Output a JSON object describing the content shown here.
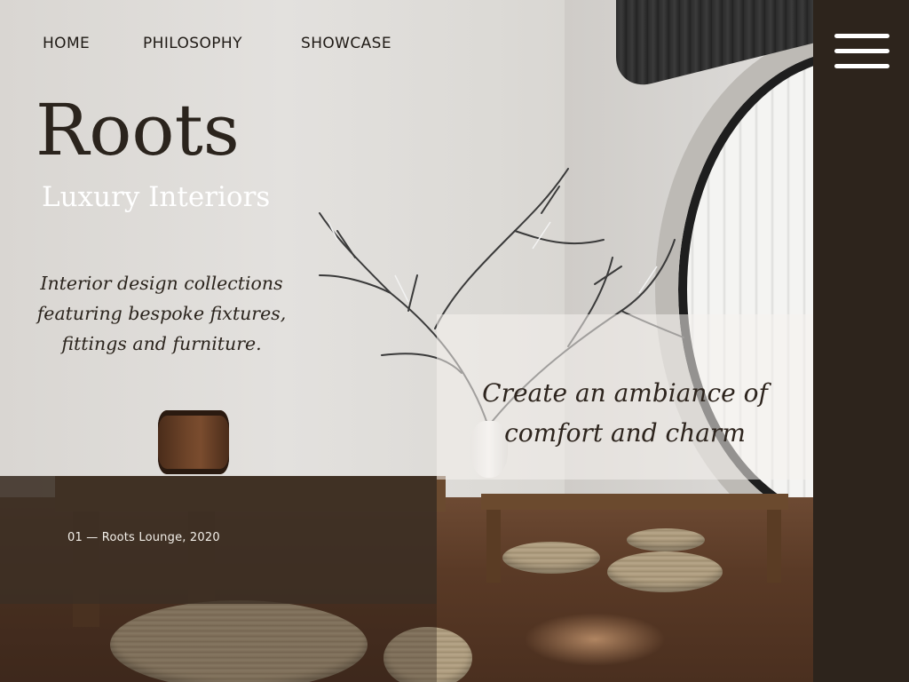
{
  "nav": {
    "items": [
      {
        "label": "HOME"
      },
      {
        "label": "PHILOSOPHY"
      },
      {
        "label": "SHOWCASE"
      }
    ]
  },
  "hero": {
    "brand": "Roots",
    "subbrand": "Luxury Interiors",
    "description": "Interior design collections featuring bespoke fixtures, fittings and furniture."
  },
  "feature": {
    "tagline": "Create an ambiance of comfort and charm",
    "caption": "01 — Roots Lounge, 2020"
  },
  "sidebar": {
    "menu_icon": "hamburger-menu-icon"
  },
  "colors": {
    "sidebar_bg": "#2d241c",
    "dark_text": "#2b241d",
    "light_text": "#ffffff",
    "band_bg": "#3a2d23"
  }
}
